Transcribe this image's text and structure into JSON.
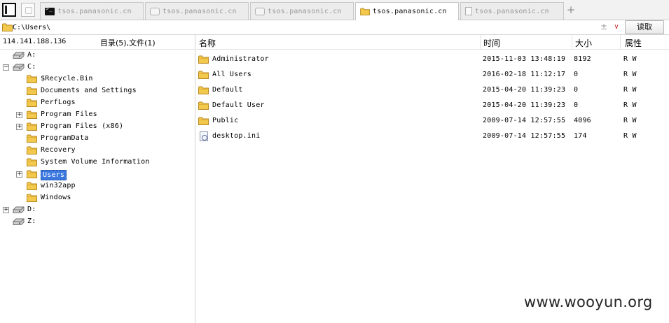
{
  "tabs": [
    {
      "label": "tsos.panasonic.cn",
      "icon": "terminal-icon",
      "active": false
    },
    {
      "label": "tsos.panasonic.cn",
      "icon": "database-icon",
      "active": false
    },
    {
      "label": "tsos.panasonic.cn",
      "icon": "database-icon",
      "active": false
    },
    {
      "label": "tsos.panasonic.cn",
      "icon": "folder-icon",
      "active": true
    },
    {
      "label": "tsos.panasonic.cn",
      "icon": "document-icon",
      "active": false
    }
  ],
  "address": {
    "path": "C:\\Users\\",
    "plusminus": "±",
    "dropdown": "∨",
    "read_button": "读取"
  },
  "left": {
    "host": "114.141.188.136",
    "summary": "目录(5),文件(1)",
    "tree": [
      {
        "label": "A:",
        "type": "drive",
        "expander": ""
      },
      {
        "label": "C:",
        "type": "drive",
        "expander": "−"
      },
      {
        "label": "$Recycle.Bin",
        "type": "folder",
        "expander": ""
      },
      {
        "label": "Documents and Settings",
        "type": "folder",
        "expander": ""
      },
      {
        "label": "PerfLogs",
        "type": "folder",
        "expander": ""
      },
      {
        "label": "Program Files",
        "type": "folder",
        "expander": "+"
      },
      {
        "label": "Program Files (x86)",
        "type": "folder",
        "expander": "+"
      },
      {
        "label": "ProgramData",
        "type": "folder",
        "expander": ""
      },
      {
        "label": "Recovery",
        "type": "folder",
        "expander": ""
      },
      {
        "label": "System Volume Information",
        "type": "folder",
        "expander": ""
      },
      {
        "label": "Users",
        "type": "folder",
        "expander": "+",
        "selected": true
      },
      {
        "label": "win32app",
        "type": "folder",
        "expander": ""
      },
      {
        "label": "Windows",
        "type": "folder",
        "expander": ""
      },
      {
        "label": "D:",
        "type": "drive",
        "expander": "+"
      },
      {
        "label": "Z:",
        "type": "drive",
        "expander": ""
      }
    ]
  },
  "files": {
    "columns": {
      "name": "名称",
      "time": "时间",
      "size": "大小",
      "attr": "属性"
    },
    "rows": [
      {
        "name": "Administrator",
        "time": "2015-11-03 13:48:19",
        "size": "8192",
        "attr": "R W",
        "type": "folder"
      },
      {
        "name": "All Users",
        "time": "2016-02-18 11:12:17",
        "size": "0",
        "attr": "R W",
        "type": "folder"
      },
      {
        "name": "Default",
        "time": "2015-04-20 11:39:23",
        "size": "0",
        "attr": "R W",
        "type": "folder"
      },
      {
        "name": "Default User",
        "time": "2015-04-20 11:39:23",
        "size": "0",
        "attr": "R W",
        "type": "folder"
      },
      {
        "name": "Public",
        "time": "2009-07-14 12:57:55",
        "size": "4096",
        "attr": "R W",
        "type": "folder"
      },
      {
        "name": "desktop.ini",
        "time": "2009-07-14 12:57:55",
        "size": "174",
        "attr": "R W",
        "type": "file"
      }
    ]
  },
  "watermark": "www.wooyun.org",
  "colors": {
    "selection": "#3b78e0",
    "folder": "#f2c94c",
    "folder_edge": "#c9972b"
  }
}
